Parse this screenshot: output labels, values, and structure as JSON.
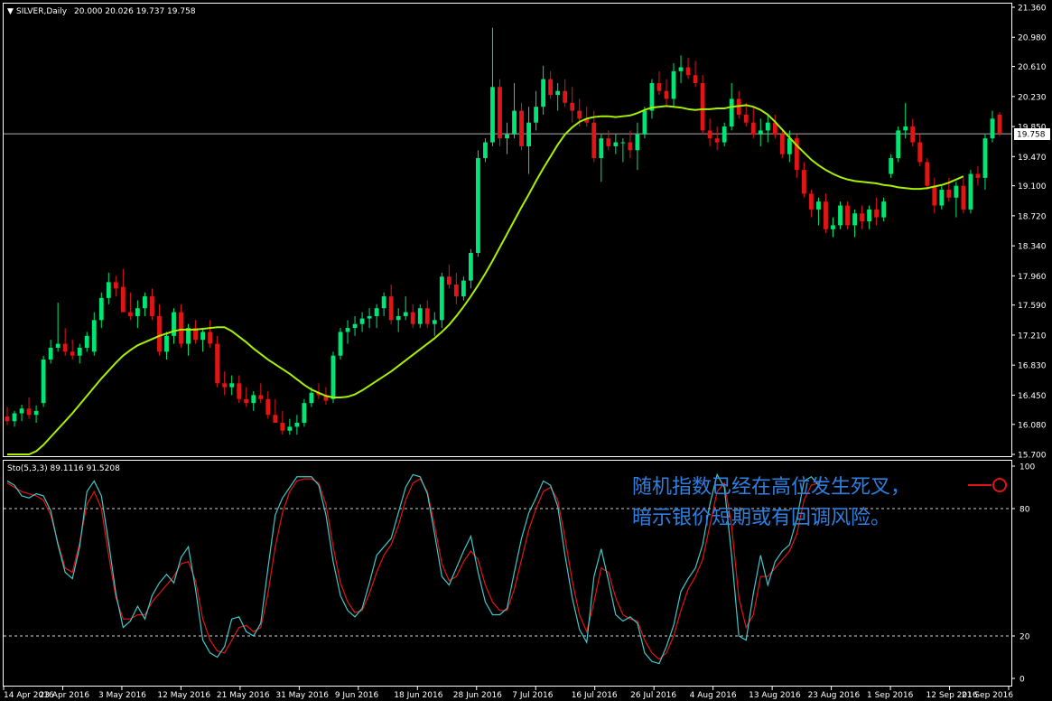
{
  "colors": {
    "background": "#000000",
    "frame": "#ffffff",
    "bull": "#00e676",
    "bear": "#e01515",
    "ma": "#a6f000",
    "stoch_main": "#40c8c8",
    "stoch_signal": "#e01515",
    "annotation": "#2f7fe0"
  },
  "header": {
    "symbol_label": "SILVER,Daily",
    "ohlc_label": "20.000 20.026 19.737 19.758"
  },
  "current_price_label": "19.758",
  "annotation": {
    "line1": "随机指数已经在高位发生死叉，",
    "line2": "暗示银价短期或有回调风险。"
  },
  "chart_data": [
    {
      "type": "candlestick",
      "symbol": "SILVER",
      "timeframe": "Daily",
      "ylim": [
        15.7,
        21.36
      ],
      "y_ticks": [
        "21.360",
        "20.980",
        "20.610",
        "20.230",
        "19.850",
        "19.470",
        "19.100",
        "18.720",
        "18.340",
        "17.960",
        "17.590",
        "17.210",
        "16.830",
        "16.450",
        "16.080",
        "15.700"
      ],
      "x_tick_labels": [
        "14 Apr 2016",
        "23 Apr 2016",
        "3 May 2016",
        "12 May 2016",
        "21 May 2016",
        "31 May 2016",
        "9 Jun 2016",
        "18 Jun 2016",
        "28 Jun 2016",
        "7 Jul 2016",
        "16 Jul 2016",
        "26 Jul 2016",
        "4 Aug 2016",
        "13 Aug 2016",
        "23 Aug 2016",
        "1 Sep 2016",
        "12 Sep 2016",
        "21 Sep 2016"
      ],
      "last_price": 19.758,
      "ma_label": "",
      "candles": [
        [
          16.18,
          16.3,
          16.07,
          16.12
        ],
        [
          16.12,
          16.25,
          16.05,
          16.22
        ],
        [
          16.22,
          16.33,
          16.12,
          16.28
        ],
        [
          16.28,
          16.42,
          16.15,
          16.2
        ],
        [
          16.2,
          16.32,
          16.1,
          16.25
        ],
        [
          16.35,
          16.95,
          16.3,
          16.9
        ],
        [
          16.9,
          17.15,
          16.85,
          17.05
        ],
        [
          17.05,
          17.62,
          17.0,
          17.1
        ],
        [
          17.1,
          17.3,
          16.95,
          17.0
        ],
        [
          17.0,
          17.15,
          16.9,
          16.95
        ],
        [
          16.95,
          17.1,
          16.85,
          17.05
        ],
        [
          17.05,
          17.25,
          17.0,
          17.2
        ],
        [
          17.0,
          17.5,
          16.95,
          17.4
        ],
        [
          17.4,
          17.75,
          17.3,
          17.68
        ],
        [
          17.68,
          18.0,
          17.6,
          17.88
        ],
        [
          17.88,
          17.96,
          17.7,
          17.8
        ],
        [
          17.82,
          18.05,
          17.6,
          17.5
        ],
        [
          17.5,
          17.75,
          17.4,
          17.45
        ],
        [
          17.45,
          17.65,
          17.3,
          17.55
        ],
        [
          17.55,
          17.75,
          17.45,
          17.7
        ],
        [
          17.7,
          17.8,
          17.4,
          17.45
        ],
        [
          17.45,
          17.6,
          16.95,
          17.0
        ],
        [
          17.0,
          17.25,
          16.9,
          17.2
        ],
        [
          17.2,
          17.55,
          17.1,
          17.5
        ],
        [
          17.5,
          17.6,
          17.05,
          17.1
        ],
        [
          17.1,
          17.35,
          16.95,
          17.3
        ],
        [
          17.3,
          17.4,
          17.1,
          17.15
        ],
        [
          17.15,
          17.3,
          17.0,
          17.25
        ],
        [
          17.25,
          17.4,
          17.05,
          17.1
        ],
        [
          17.1,
          17.2,
          16.55,
          16.6
        ],
        [
          16.6,
          16.75,
          16.45,
          16.55
        ],
        [
          16.55,
          16.7,
          16.45,
          16.6
        ],
        [
          16.6,
          16.7,
          16.35,
          16.4
        ],
        [
          16.4,
          16.55,
          16.3,
          16.35
        ],
        [
          16.35,
          16.5,
          16.25,
          16.45
        ],
        [
          16.45,
          16.6,
          16.35,
          16.4
        ],
        [
          16.4,
          16.5,
          16.15,
          16.2
        ],
        [
          16.2,
          16.4,
          16.1,
          16.1
        ],
        [
          16.1,
          16.25,
          15.95,
          16.0
        ],
        [
          16.0,
          16.15,
          15.95,
          16.05
        ],
        [
          16.05,
          16.2,
          15.95,
          16.1
        ],
        [
          16.1,
          16.4,
          16.05,
          16.35
        ],
        [
          16.35,
          16.55,
          16.3,
          16.48
        ],
        [
          16.48,
          16.6,
          16.4,
          16.45
        ],
        [
          16.45,
          16.55,
          16.33,
          16.38
        ],
        [
          16.4,
          17.0,
          16.35,
          16.95
        ],
        [
          16.95,
          17.3,
          16.9,
          17.25
        ],
        [
          17.25,
          17.4,
          17.1,
          17.3
        ],
        [
          17.3,
          17.45,
          17.2,
          17.35
        ],
        [
          17.35,
          17.5,
          17.25,
          17.42
        ],
        [
          17.42,
          17.55,
          17.3,
          17.45
        ],
        [
          17.45,
          17.6,
          17.3,
          17.55
        ],
        [
          17.55,
          17.75,
          17.45,
          17.7
        ],
        [
          17.7,
          17.85,
          17.35,
          17.4
        ],
        [
          17.4,
          17.55,
          17.25,
          17.45
        ],
        [
          17.45,
          17.7,
          17.4,
          17.5
        ],
        [
          17.5,
          17.6,
          17.3,
          17.35
        ],
        [
          17.35,
          17.6,
          17.3,
          17.55
        ],
        [
          17.55,
          17.65,
          17.3,
          17.35
        ],
        [
          17.35,
          17.5,
          17.2,
          17.4
        ],
        [
          17.4,
          18.0,
          17.3,
          17.95
        ],
        [
          17.95,
          18.1,
          17.8,
          17.85
        ],
        [
          17.85,
          18.0,
          17.6,
          17.7
        ],
        [
          17.7,
          17.95,
          17.65,
          17.9
        ],
        [
          17.9,
          18.3,
          17.8,
          18.25
        ],
        [
          18.25,
          19.55,
          18.2,
          19.45
        ],
        [
          19.45,
          19.7,
          19.4,
          19.65
        ],
        [
          19.65,
          21.1,
          19.6,
          20.35
        ],
        [
          20.35,
          20.45,
          19.6,
          19.7
        ],
        [
          19.7,
          19.9,
          19.5,
          19.75
        ],
        [
          19.75,
          20.4,
          19.7,
          20.05
        ],
        [
          20.05,
          20.15,
          19.55,
          19.6
        ],
        [
          19.6,
          20.1,
          19.25,
          19.9
        ],
        [
          19.9,
          20.3,
          19.8,
          20.1
        ],
        [
          20.1,
          20.62,
          20.0,
          20.45
        ],
        [
          20.45,
          20.55,
          20.2,
          20.25
        ],
        [
          20.25,
          20.4,
          20.05,
          20.3
        ],
        [
          20.3,
          20.45,
          20.1,
          20.15
        ],
        [
          20.15,
          20.35,
          19.9,
          20.05
        ],
        [
          20.05,
          20.2,
          19.85,
          19.95
        ],
        [
          19.95,
          20.1,
          19.85,
          19.9
        ],
        [
          19.9,
          20.05,
          19.4,
          19.45
        ],
        [
          19.45,
          19.75,
          19.15,
          19.7
        ],
        [
          19.7,
          19.8,
          19.55,
          19.6
        ],
        [
          19.6,
          19.75,
          19.5,
          19.65
        ],
        [
          19.65,
          19.7,
          19.4,
          19.65
        ],
        [
          19.65,
          19.8,
          19.45,
          19.55
        ],
        [
          19.55,
          19.9,
          19.3,
          19.75
        ],
        [
          19.75,
          20.1,
          19.7,
          20.05
        ],
        [
          20.05,
          20.45,
          19.95,
          20.4
        ],
        [
          20.4,
          20.55,
          20.25,
          20.3
        ],
        [
          20.3,
          20.45,
          20.1,
          20.2
        ],
        [
          20.2,
          20.65,
          20.1,
          20.55
        ],
        [
          20.55,
          20.75,
          20.4,
          20.6
        ],
        [
          20.6,
          20.72,
          20.45,
          20.5
        ],
        [
          20.5,
          20.68,
          20.35,
          20.4
        ],
        [
          20.4,
          20.5,
          19.75,
          19.8
        ],
        [
          19.8,
          19.95,
          19.6,
          19.7
        ],
        [
          19.7,
          19.85,
          19.55,
          19.65
        ],
        [
          19.65,
          19.9,
          19.6,
          19.85
        ],
        [
          19.85,
          20.4,
          19.8,
          20.2
        ],
        [
          20.2,
          20.3,
          19.95,
          20.0
        ],
        [
          20.0,
          20.15,
          19.85,
          19.9
        ],
        [
          19.9,
          20.1,
          19.7,
          19.75
        ],
        [
          19.75,
          19.95,
          19.6,
          19.8
        ],
        [
          19.8,
          20.0,
          19.65,
          19.9
        ],
        [
          19.9,
          20.0,
          19.7,
          19.75
        ],
        [
          19.75,
          19.8,
          19.45,
          19.5
        ],
        [
          19.5,
          19.8,
          19.4,
          19.7
        ],
        [
          19.7,
          19.75,
          19.2,
          19.3
        ],
        [
          19.3,
          19.4,
          18.95,
          19.0
        ],
        [
          19.0,
          19.05,
          18.7,
          18.8
        ],
        [
          18.8,
          18.95,
          18.6,
          18.9
        ],
        [
          18.9,
          19.0,
          18.5,
          18.55
        ],
        [
          18.55,
          18.7,
          18.45,
          18.6
        ],
        [
          18.6,
          18.9,
          18.55,
          18.85
        ],
        [
          18.85,
          18.9,
          18.55,
          18.6
        ],
        [
          18.6,
          18.8,
          18.45,
          18.75
        ],
        [
          18.75,
          18.85,
          18.55,
          18.65
        ],
        [
          18.65,
          18.85,
          18.55,
          18.8
        ],
        [
          18.8,
          18.95,
          18.6,
          18.7
        ],
        [
          18.7,
          18.95,
          18.65,
          18.9
        ],
        [
          19.25,
          19.5,
          19.2,
          19.45
        ],
        [
          19.45,
          19.85,
          19.4,
          19.8
        ],
        [
          19.8,
          20.15,
          19.7,
          19.85
        ],
        [
          19.85,
          19.95,
          19.6,
          19.65
        ],
        [
          19.65,
          19.75,
          19.35,
          19.4
        ],
        [
          19.4,
          19.45,
          19.05,
          19.1
        ],
        [
          19.1,
          19.2,
          18.75,
          18.85
        ],
        [
          18.85,
          19.1,
          18.8,
          19.05
        ],
        [
          19.05,
          19.2,
          18.9,
          18.95
        ],
        [
          18.95,
          19.15,
          18.7,
          19.1
        ],
        [
          19.1,
          19.2,
          18.75,
          18.8
        ],
        [
          18.8,
          19.3,
          18.75,
          19.25
        ],
        [
          19.25,
          19.35,
          19.1,
          19.2
        ],
        [
          19.2,
          19.75,
          19.05,
          19.7
        ],
        [
          19.7,
          20.05,
          19.65,
          19.95
        ],
        [
          20.0,
          20.03,
          19.73,
          19.76
        ]
      ],
      "ma_values": [
        15.5,
        15.56,
        15.62,
        15.68,
        15.74,
        15.82,
        15.92,
        16.02,
        16.12,
        16.22,
        16.33,
        16.44,
        16.55,
        16.66,
        16.76,
        16.86,
        16.95,
        17.02,
        17.08,
        17.12,
        17.16,
        17.2,
        17.23,
        17.26,
        17.28,
        17.28,
        17.28,
        17.29,
        17.3,
        17.31,
        17.31,
        17.26,
        17.19,
        17.12,
        17.04,
        16.97,
        16.9,
        16.84,
        16.78,
        16.72,
        16.65,
        16.58,
        16.52,
        16.48,
        16.44,
        16.42,
        16.42,
        16.43,
        16.46,
        16.51,
        16.57,
        16.63,
        16.69,
        16.75,
        16.82,
        16.89,
        16.96,
        17.03,
        17.1,
        17.17,
        17.25,
        17.34,
        17.45,
        17.57,
        17.7,
        17.84,
        17.99,
        18.15,
        18.32,
        18.49,
        18.66,
        18.83,
        18.99,
        19.16,
        19.32,
        19.47,
        19.62,
        19.75,
        19.84,
        19.91,
        19.95,
        19.97,
        19.98,
        19.98,
        19.97,
        19.98,
        19.99,
        20.02,
        20.06,
        20.09,
        20.1,
        20.11,
        20.1,
        20.09,
        20.07,
        20.06,
        20.07,
        20.07,
        20.08,
        20.08,
        20.1,
        20.11,
        20.12,
        20.1,
        20.06,
        20.0,
        19.91,
        19.81,
        19.71,
        19.61,
        19.52,
        19.43,
        19.36,
        19.3,
        19.25,
        19.21,
        19.18,
        19.16,
        19.15,
        19.14,
        19.13,
        19.11,
        19.1,
        19.08,
        19.07,
        19.06,
        19.06,
        19.07,
        19.09,
        19.11,
        19.14,
        19.18,
        19.22
      ]
    },
    {
      "type": "line",
      "title": "Sto(5,3,3) 89.1116 91.5208",
      "ylim": [
        0,
        100
      ],
      "y_ticks": [
        "100",
        "80",
        "20",
        "0"
      ],
      "levels": [
        20,
        80
      ],
      "series": [
        {
          "name": "main",
          "values": [
            93,
            91,
            86,
            85,
            87,
            86,
            79,
            63,
            50,
            47,
            62,
            88,
            93,
            86,
            64,
            40,
            24,
            27,
            34,
            28,
            39,
            45,
            49,
            45,
            57,
            62,
            42,
            18,
            12,
            10,
            15,
            28,
            29,
            22,
            20,
            26,
            52,
            77,
            85,
            90,
            95,
            95,
            95,
            91,
            77,
            55,
            39,
            32,
            29,
            33,
            45,
            58,
            62,
            66,
            78,
            90,
            96,
            95,
            87,
            68,
            48,
            44,
            52,
            60,
            67,
            50,
            36,
            30,
            30,
            33,
            50,
            66,
            78,
            85,
            93,
            91,
            81,
            58,
            38,
            23,
            17,
            48,
            61,
            46,
            30,
            27,
            29,
            26,
            12,
            8,
            7,
            15,
            25,
            41,
            47,
            52,
            63,
            82,
            96,
            90,
            58,
            20,
            18,
            40,
            58,
            44,
            55,
            60,
            63,
            75,
            93,
            95,
            91
          ]
        },
        {
          "name": "signal",
          "values": [
            92,
            90,
            88,
            87,
            86,
            84,
            77,
            64,
            52,
            50,
            64,
            82,
            88,
            80,
            58,
            38,
            28,
            28,
            30,
            30,
            36,
            40,
            44,
            48,
            54,
            55,
            46,
            28,
            18,
            13,
            12,
            18,
            24,
            25,
            22,
            24,
            40,
            62,
            78,
            88,
            93,
            94,
            94,
            92,
            82,
            62,
            45,
            36,
            31,
            32,
            40,
            50,
            58,
            63,
            72,
            84,
            92,
            94,
            88,
            72,
            54,
            46,
            48,
            55,
            60,
            56,
            44,
            36,
            32,
            32,
            42,
            56,
            70,
            80,
            88,
            90,
            84,
            66,
            46,
            30,
            22,
            36,
            52,
            50,
            38,
            30,
            28,
            27,
            18,
            12,
            9,
            12,
            20,
            32,
            42,
            48,
            56,
            72,
            88,
            92,
            72,
            38,
            24,
            30,
            48,
            48,
            52,
            56,
            60,
            68,
            84,
            91,
            92
          ]
        }
      ]
    }
  ]
}
